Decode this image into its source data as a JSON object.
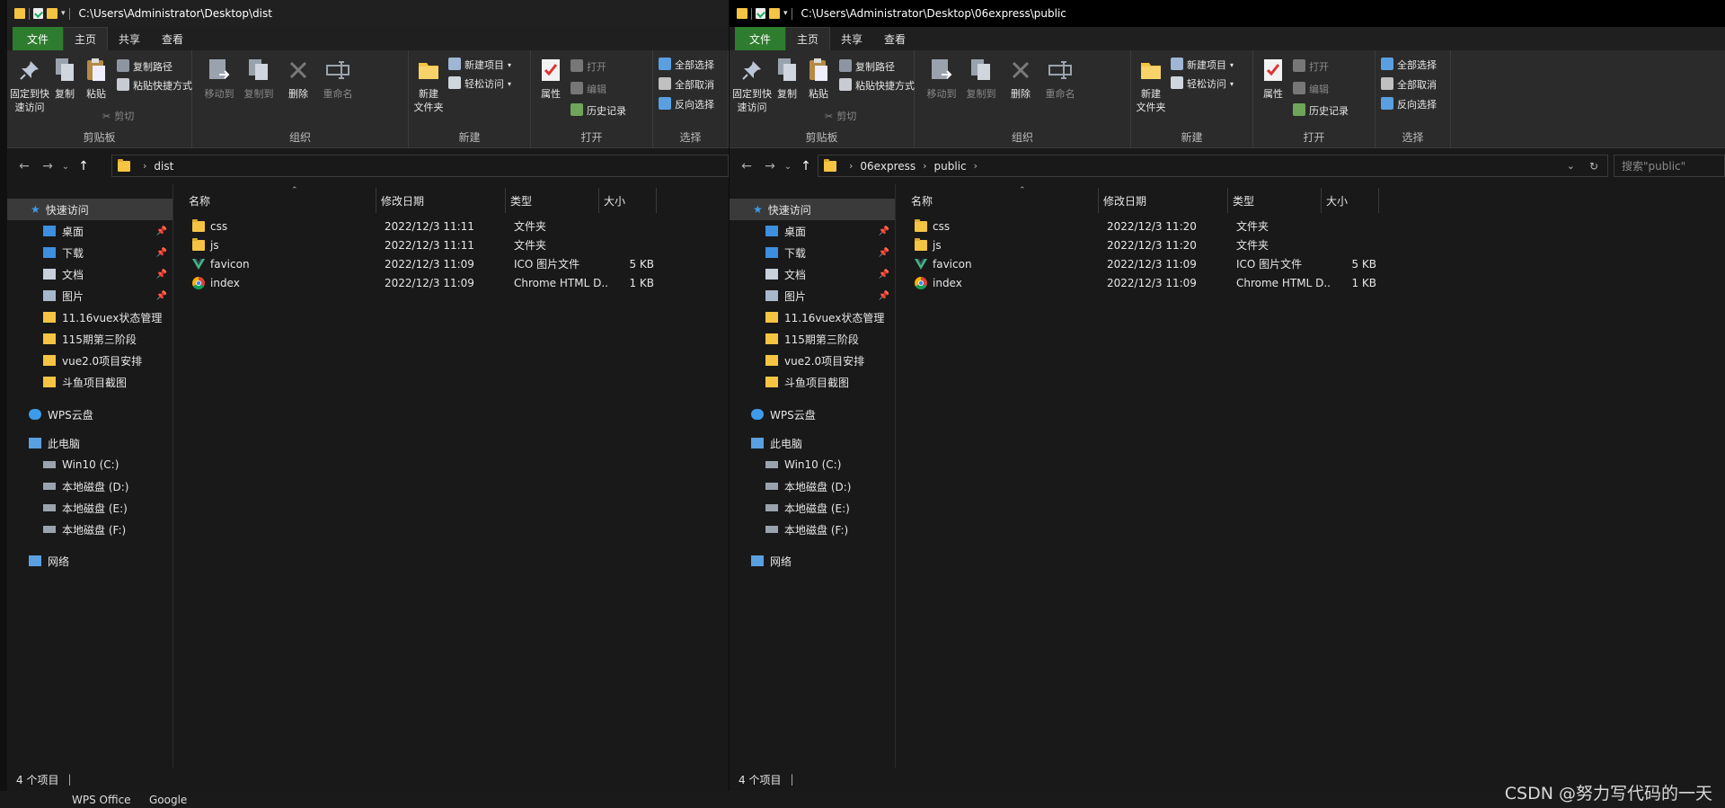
{
  "desktop": {
    "taskbar_items": [
      "WPS Office",
      "Google"
    ]
  },
  "ribbon_common": {
    "tabs": [
      "文件",
      "主页",
      "共享",
      "查看"
    ],
    "clipboard": {
      "pin": [
        "固定到快",
        "速访问"
      ],
      "copy": "复制",
      "paste": "粘贴",
      "copy_path": "复制路径",
      "paste_shortcut": "粘贴快捷方式",
      "cut": "剪切",
      "group": "剪贴板"
    },
    "organize": {
      "move_to": "移动到",
      "copy_to": "复制到",
      "delete": "删除",
      "rename": "重命名",
      "group": "组织"
    },
    "new": {
      "new_folder": [
        "新建",
        "文件夹"
      ],
      "new_item": "新建项目",
      "easy_access": "轻松访问",
      "group": "新建"
    },
    "open": {
      "properties": "属性",
      "open": "打开",
      "edit": "编辑",
      "history": "历史记录",
      "group": "打开"
    },
    "select": {
      "select_all": "全部选择",
      "select_none": "全部取消",
      "invert": "反向选择",
      "group": "选择"
    }
  },
  "columns": {
    "name": "名称",
    "date": "修改日期",
    "type": "类型",
    "size": "大小"
  },
  "nav": {
    "quick_access": "快速访问",
    "pinned": [
      {
        "label": "桌面",
        "icon": "desktop-icon"
      },
      {
        "label": "下载",
        "icon": "download-icon"
      },
      {
        "label": "文档",
        "icon": "document-icon"
      },
      {
        "label": "图片",
        "icon": "picture-icon"
      }
    ],
    "recent": [
      "11.16vuex状态管理",
      "115期第三阶段",
      "vue2.0项目安排",
      "斗鱼项目截图"
    ],
    "wps_cloud": "WPS云盘",
    "this_pc": "此电脑",
    "drives": [
      "Win10 (C:)",
      "本地磁盘 (D:)",
      "本地磁盘 (E:)",
      "本地磁盘 (F:)"
    ],
    "network": "网络"
  },
  "left_window": {
    "title_path": "C:\\Users\\Administrator\\Desktop\\dist",
    "breadcrumb": [
      "dist"
    ],
    "status": "4 个项目",
    "files": [
      {
        "name": "css",
        "date": "2022/12/3 11:11",
        "type": "文件夹",
        "size": "",
        "icon": "folder-icon"
      },
      {
        "name": "js",
        "date": "2022/12/3 11:11",
        "type": "文件夹",
        "size": "",
        "icon": "folder-icon"
      },
      {
        "name": "favicon",
        "date": "2022/12/3 11:09",
        "type": "ICO 图片文件",
        "size": "5 KB",
        "icon": "vue-logo-icon"
      },
      {
        "name": "index",
        "date": "2022/12/3 11:09",
        "type": "Chrome HTML D...",
        "size": "1 KB",
        "icon": "chrome-icon"
      }
    ]
  },
  "right_window": {
    "title_path": "C:\\Users\\Administrator\\Desktop\\06express\\public",
    "breadcrumb": [
      "06express",
      "public"
    ],
    "search_placeholder": "搜索\"public\"",
    "status": "4 个项目",
    "files": [
      {
        "name": "css",
        "date": "2022/12/3 11:20",
        "type": "文件夹",
        "size": "",
        "icon": "folder-icon"
      },
      {
        "name": "js",
        "date": "2022/12/3 11:20",
        "type": "文件夹",
        "size": "",
        "icon": "folder-icon"
      },
      {
        "name": "favicon",
        "date": "2022/12/3 11:09",
        "type": "ICO 图片文件",
        "size": "5 KB",
        "icon": "vue-logo-icon"
      },
      {
        "name": "index",
        "date": "2022/12/3 11:09",
        "type": "Chrome HTML D...",
        "size": "1 KB",
        "icon": "chrome-icon"
      }
    ]
  },
  "watermark": "CSDN @努力写代码的一天"
}
